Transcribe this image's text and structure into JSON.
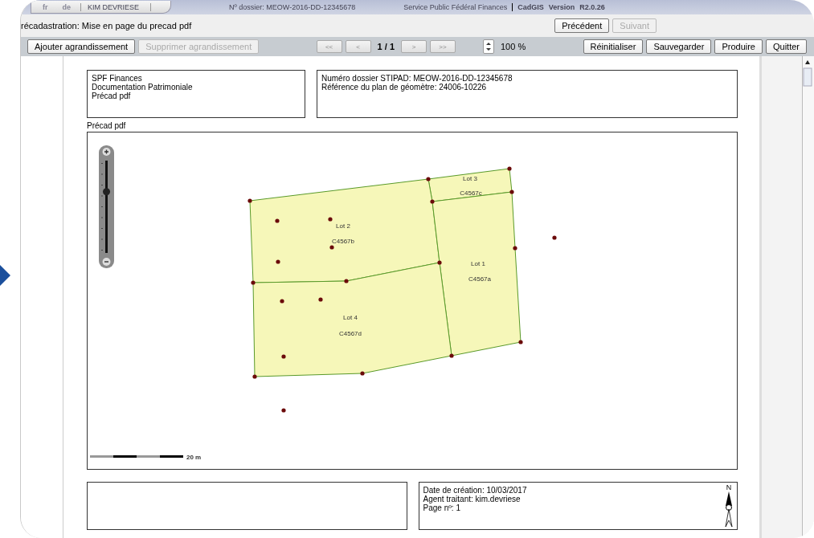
{
  "top_bar": {
    "languages": [
      {
        "label": "fr",
        "selected": false
      },
      {
        "label": "de",
        "selected": false
      }
    ],
    "user": "KIM DEVRIESE",
    "dossier": "Nº dossier: MEOW-2016-DD-12345678",
    "organization": "Service Public Fédéral Finances",
    "app_name": "CadGIS",
    "version_label": "Version",
    "version": "R2.0.26"
  },
  "header": {
    "title": "récadastration: Mise en page du precad pdf",
    "buttons": [
      {
        "label": "Précédent",
        "disabled": false
      },
      {
        "label": "Suivant",
        "disabled": true
      }
    ]
  },
  "toolbar": {
    "left_buttons": [
      {
        "label": "Ajouter agrandissement",
        "disabled": false
      },
      {
        "label": "Supprimer agrandissement",
        "disabled": true
      }
    ],
    "nav_buttons": [
      "<<",
      "<"
    ],
    "page": "1 / 1",
    "nav_buttons_after": [
      ">",
      ">>"
    ],
    "zoom": "100 %",
    "right_buttons": [
      {
        "label": "Réinitialiser",
        "disabled": false
      },
      {
        "label": "Sauvegarder",
        "disabled": false
      },
      {
        "label": "Produire",
        "disabled": false
      },
      {
        "label": "Quitter",
        "disabled": false
      }
    ]
  },
  "page": {
    "org_box": [
      "SPF Finances",
      "Documentation Patrimoniale",
      "Précad pdf"
    ],
    "ref_box": [
      "Numéro dossier STIPAD: MEOW-2016-DD-12345678",
      "Référence du plan de géomètre: 24006-10226"
    ],
    "map_title": "Précad pdf",
    "map": {
      "zoom_slider": {
        "level": 0.6
      },
      "lots": [
        {
          "label": "Lot 3",
          "parcel": "C4567c"
        },
        {
          "label": "Lot 2",
          "parcel": "C4567b"
        },
        {
          "label": "Lot 1",
          "parcel": "C4567a"
        },
        {
          "label": "Lot 4",
          "parcel": "C4567d"
        }
      ],
      "scale": "20 m"
    },
    "footer_box": [
      "Date de création: 10/03/2017",
      "Agent traitant: kim.devriese",
      "Page nº: 1"
    ],
    "north_label": "N"
  }
}
